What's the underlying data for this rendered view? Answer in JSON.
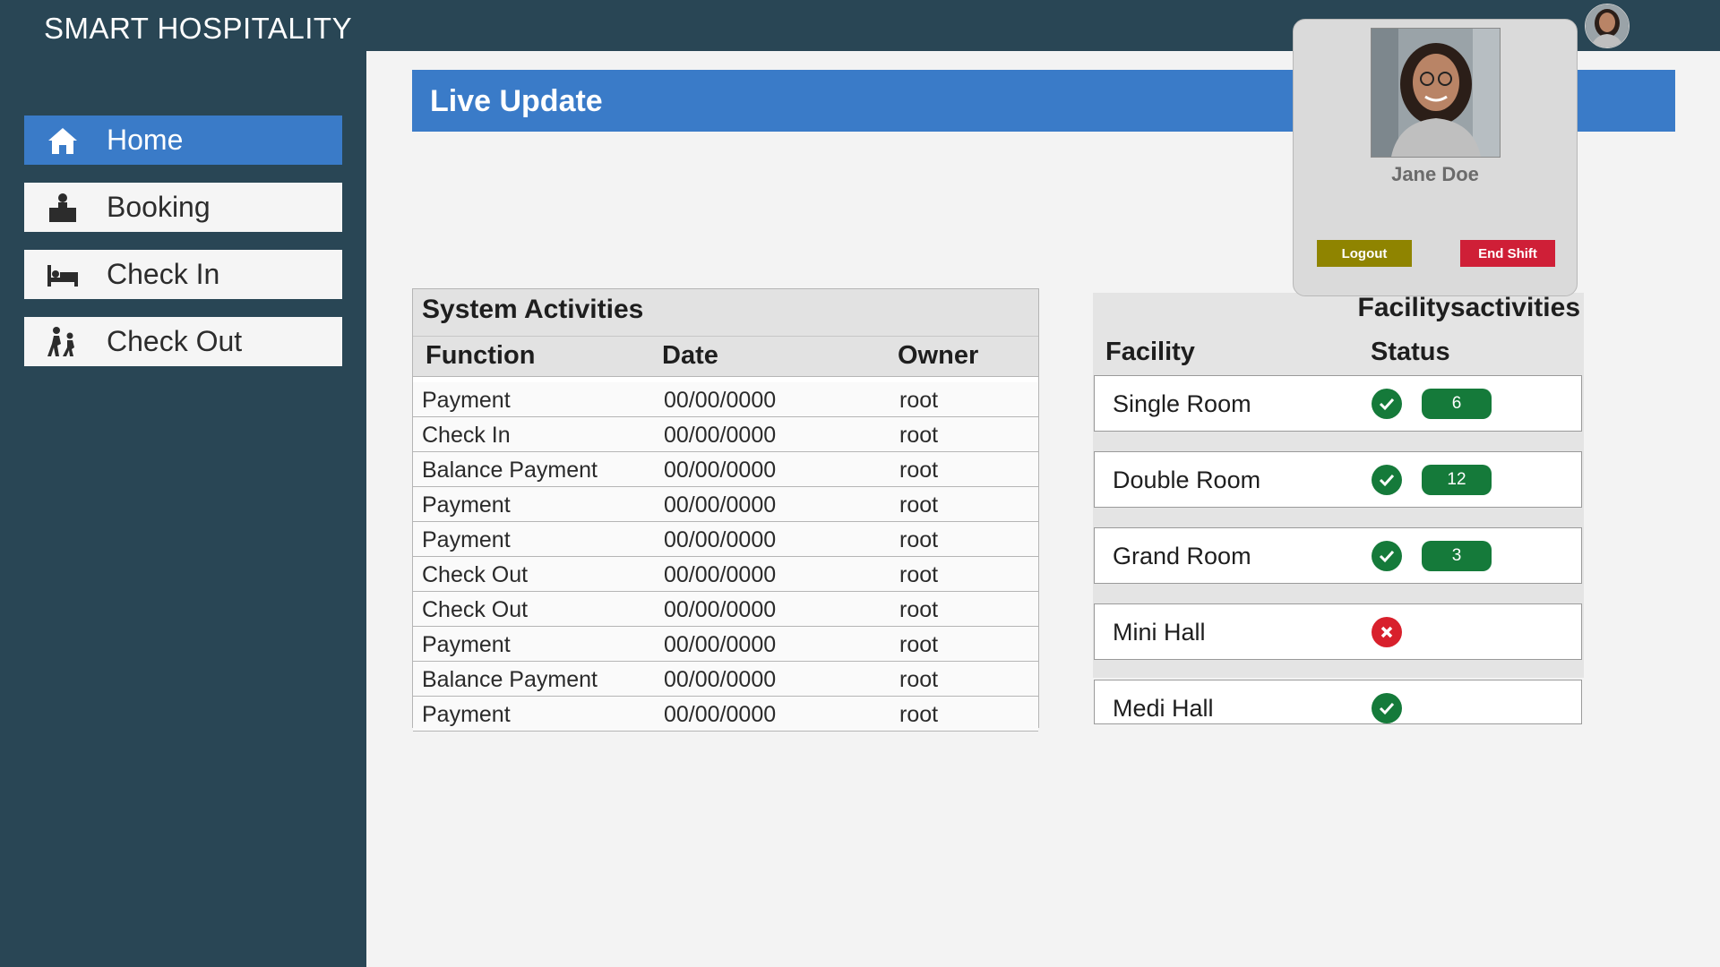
{
  "app": {
    "title": "SMART HOSPITALITY"
  },
  "sidebar": {
    "items": [
      {
        "label": "Home",
        "icon": "home-icon",
        "active": true
      },
      {
        "label": "Booking",
        "icon": "desk-icon",
        "active": false
      },
      {
        "label": "Check In",
        "icon": "bed-icon",
        "active": false
      },
      {
        "label": "Check Out",
        "icon": "walking-people-icon",
        "active": false
      }
    ]
  },
  "live_update": {
    "title": "Live Update"
  },
  "system_activities": {
    "title": "System Activities",
    "columns": [
      "Function",
      "Date",
      "Owner"
    ],
    "rows": [
      [
        "Payment",
        "00/00/0000",
        "root"
      ],
      [
        "Check In",
        "00/00/0000",
        "root"
      ],
      [
        "Balance Payment",
        "00/00/0000",
        "root"
      ],
      [
        "Payment",
        "00/00/0000",
        "root"
      ],
      [
        "Payment",
        "00/00/0000",
        "root"
      ],
      [
        "Check Out",
        "00/00/0000",
        "root"
      ],
      [
        "Check Out",
        "00/00/0000",
        "root"
      ],
      [
        "Payment",
        "00/00/0000",
        "root"
      ],
      [
        "Balance Payment",
        "00/00/0000",
        "root"
      ],
      [
        "Payment",
        "00/00/0000",
        "root"
      ]
    ]
  },
  "facility_activities": {
    "title": "Facilitysactivities",
    "columns": [
      "Facility",
      "Status"
    ],
    "rows": [
      {
        "name": "Single Room",
        "status": "available",
        "count": "6"
      },
      {
        "name": "Double Room",
        "status": "available",
        "count": "12"
      },
      {
        "name": "Grand Room",
        "status": "available",
        "count": "3"
      },
      {
        "name": "Mini Hall",
        "status": "unavailable",
        "count": ""
      },
      {
        "name": "Medi Hall",
        "status": "available",
        "count": ""
      }
    ]
  },
  "profile": {
    "name": "Jane Doe",
    "logout_label": "Logout",
    "end_shift_label": "End Shift"
  },
  "colors": {
    "topbar": "#294655",
    "accent": "#3a7bc8",
    "ok": "#157a3a",
    "error": "#d8202c",
    "logout": "#8f8400",
    "end_shift": "#cf1f37"
  }
}
